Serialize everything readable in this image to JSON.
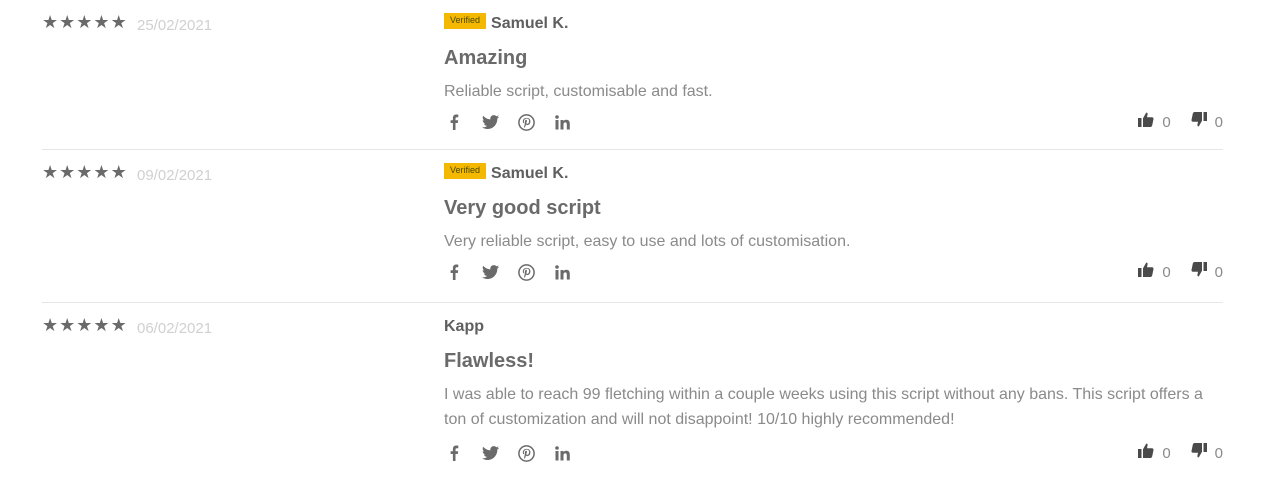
{
  "reviews": [
    {
      "stars": [
        "★",
        "★",
        "★",
        "★",
        "★"
      ],
      "date": "25/02/2021",
      "verified": "Verified",
      "author": "Samuel K.",
      "title": "Amazing",
      "body": "Reliable script, customisable and fast.",
      "thumbs_up": "0",
      "thumbs_down": "0"
    },
    {
      "stars": [
        "★",
        "★",
        "★",
        "★",
        "★"
      ],
      "date": "09/02/2021",
      "verified": "Verified",
      "author": "Samuel K.",
      "title": "Very good script",
      "body": "Very reliable script, easy to use and lots of customisation.",
      "thumbs_up": "0",
      "thumbs_down": "0"
    },
    {
      "stars": [
        "★",
        "★",
        "★",
        "★",
        "★"
      ],
      "date": "06/02/2021",
      "author": "Kapp",
      "title": "Flawless!",
      "body": "I was able to reach 99 fletching within a couple weeks using this script without any bans. This script offers a ton of customization and will not disappoint! 10/10 highly recommended!",
      "thumbs_up": "0",
      "thumbs_down": "0"
    }
  ],
  "share_icons": [
    "facebook-icon",
    "twitter-icon",
    "pinterest-icon",
    "linkedin-icon"
  ],
  "colors": {
    "verified_badge": "#f5b800",
    "star": "#6a6a6a",
    "date": "#d0d0d0",
    "divider": "#e6e6e6"
  }
}
